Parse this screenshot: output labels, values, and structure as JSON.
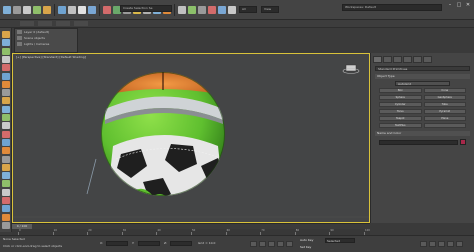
{
  "toolbar": {
    "filter_label": "All",
    "view_label": "View",
    "selection_set_placeholder": "Create Selection Se",
    "workspace_label": "Workspaces: Default",
    "window_controls": [
      "–",
      "□",
      "✕"
    ],
    "icon_colors": [
      "#7fb0d8",
      "#9a9a9a",
      "#c9c9c9",
      "#8fbf6a",
      "#d9a54a",
      "#6fa3d1",
      "#c0c0c0",
      "#e2e2e2",
      "#7aa7d4",
      "#d36b6b",
      "#6aa86a",
      "#9a9a9a",
      "#d9b84a",
      "#b0b0b0",
      "#7fb0d8",
      "#e08a3a",
      "#c0c0c0",
      "#8cc06a",
      "#9a9a9a",
      "#d36b6b",
      "#7aa7d4",
      "#c9c9c9"
    ]
  },
  "explorer": {
    "rows": [
      "Layer 0 (default)",
      "Scene objects",
      "Lights / Cameras"
    ]
  },
  "viewport": {
    "label": "[+] [Perspective] [Standard] [Default Shading]",
    "border_color": "#d9c23a",
    "object_colors": {
      "green": "#5fbf2f",
      "orange": "#e07a2a",
      "white": "#e6e6e6",
      "dark": "#1f1f1f"
    }
  },
  "command_panel": {
    "category": "Standard Primitives",
    "object_type_header": "Object Type",
    "autogrid_label": "AutoGrid",
    "buttons": [
      "Box",
      "Cone",
      "Sphere",
      "GeoSphere",
      "Cylinder",
      "Tube",
      "Torus",
      "Pyramid",
      "Teapot",
      "Plane",
      "TextPlus",
      ""
    ],
    "name_color_header": "Name and Color",
    "object_color": "#a8284a"
  },
  "timeline": {
    "slider_label": "0 / 100",
    "ticks": [
      "0",
      "10",
      "20",
      "30",
      "40",
      "50",
      "60",
      "70",
      "80",
      "90",
      "100"
    ]
  },
  "status": {
    "selection_text": "None Selected",
    "prompt_text": "Click or click-and-drag to select objects",
    "coords": {
      "x_label": "X:",
      "y_label": "Y:",
      "z_label": "Z:"
    },
    "grid_label": "Grid = 10.0",
    "autokey_label": "Auto Key",
    "setkey_label": "Set Key",
    "selected_label": "Selected"
  }
}
